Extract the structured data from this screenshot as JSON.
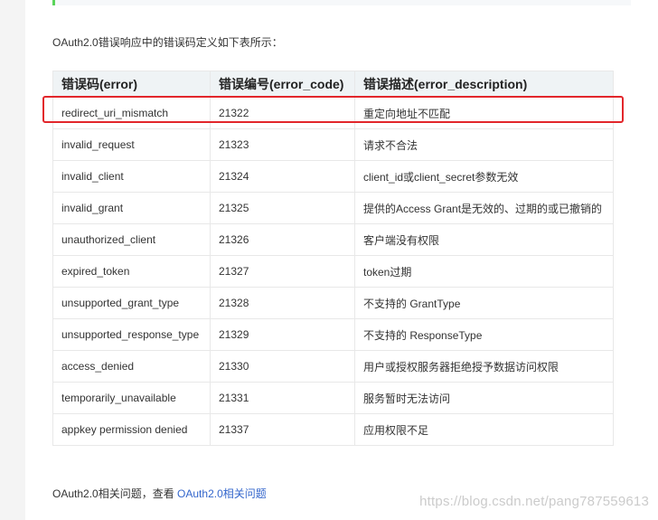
{
  "intro_text": "OAuth2.0错误响应中的错误码定义如下表所示：",
  "table": {
    "headers": [
      "错误码(error)",
      "错误编号(error_code)",
      "错误描述(error_description)"
    ],
    "rows": [
      [
        "redirect_uri_mismatch",
        "21322",
        "重定向地址不匹配"
      ],
      [
        "invalid_request",
        "21323",
        "请求不合法"
      ],
      [
        "invalid_client",
        "21324",
        "client_id或client_secret参数无效"
      ],
      [
        "invalid_grant",
        "21325",
        "提供的Access Grant是无效的、过期的或已撤销的"
      ],
      [
        "unauthorized_client",
        "21326",
        "客户端没有权限"
      ],
      [
        "expired_token",
        "21327",
        "token过期"
      ],
      [
        "unsupported_grant_type",
        "21328",
        "不支持的 GrantType"
      ],
      [
        "unsupported_response_type",
        "21329",
        "不支持的 ResponseType"
      ],
      [
        "access_denied",
        "21330",
        "用户或授权服务器拒绝授予数据访问权限"
      ],
      [
        "temporarily_unavailable",
        "21331",
        "服务暂时无法访问"
      ],
      [
        "appkey permission denied",
        "21337",
        "应用权限不足"
      ]
    ],
    "highlighted_row": 0
  },
  "related": {
    "prefix": "OAuth2.0相关问题，查看 ",
    "link_text": "OAuth2.0相关问题"
  },
  "watermark": "https://blog.csdn.net/pang787559613",
  "colors": {
    "highlight_border": "#e2262b",
    "link": "#3366cc",
    "header_bg": "#eff3f5",
    "code_block_border": "#5bd45b"
  }
}
